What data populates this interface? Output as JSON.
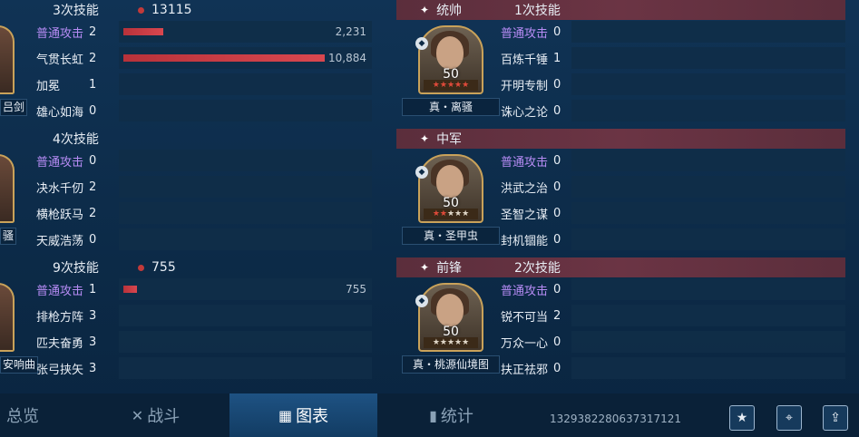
{
  "left_groups": [
    {
      "header": {
        "count": "3次技能",
        "damage": "13115"
      },
      "hero_name_fragment": "吕剑",
      "rows": [
        {
          "name": "普通攻击",
          "level": "2",
          "value": "2,231",
          "fraction": 0.16,
          "purple": true
        },
        {
          "name": "气贯长虹",
          "level": "2",
          "value": "10,884",
          "fraction": 0.8,
          "purple": false
        },
        {
          "name": "加冕",
          "level": "1",
          "value": "",
          "fraction": 0,
          "purple": false
        },
        {
          "name": "雄心如海",
          "level": "0",
          "value": "",
          "fraction": 0,
          "purple": false
        }
      ]
    },
    {
      "header": {
        "count": "4次技能",
        "damage": ""
      },
      "hero_name_fragment": "骚",
      "rows": [
        {
          "name": "普通攻击",
          "level": "0",
          "value": "",
          "fraction": 0,
          "purple": true
        },
        {
          "name": "决水千仞",
          "level": "2",
          "value": "",
          "fraction": 0,
          "purple": false
        },
        {
          "name": "横枪跃马",
          "level": "2",
          "value": "",
          "fraction": 0,
          "purple": false
        },
        {
          "name": "天威浩荡",
          "level": "0",
          "value": "",
          "fraction": 0,
          "purple": false
        }
      ]
    },
    {
      "header": {
        "count": "9次技能",
        "damage": "755"
      },
      "hero_name_fragment": "安响曲",
      "rows": [
        {
          "name": "普通攻击",
          "level": "1",
          "value": "755",
          "fraction": 0.055,
          "purple": true
        },
        {
          "name": "排枪方阵",
          "level": "3",
          "value": "",
          "fraction": 0,
          "purple": false
        },
        {
          "name": "匹夫奋勇",
          "level": "3",
          "value": "",
          "fraction": 0,
          "purple": false
        },
        {
          "name": "张弓挟矢",
          "level": "3",
          "value": "",
          "fraction": 0,
          "purple": false
        }
      ]
    }
  ],
  "right_groups": [
    {
      "header": {
        "role": "统帅",
        "count": "1次技能"
      },
      "hero": {
        "level": "50",
        "name": "真・离骚",
        "stars_red": 5,
        "stars_total": 5
      },
      "rows": [
        {
          "name": "普通攻击",
          "level": "0",
          "purple": true
        },
        {
          "name": "百炼千锤",
          "level": "1",
          "purple": false
        },
        {
          "name": "开明专制",
          "level": "0",
          "purple": false
        },
        {
          "name": "诛心之论",
          "level": "0",
          "purple": false
        }
      ]
    },
    {
      "header": {
        "role": "中军",
        "count": ""
      },
      "hero": {
        "level": "50",
        "name": "真・圣甲虫",
        "stars_red": 2,
        "stars_total": 5
      },
      "rows": [
        {
          "name": "普通攻击",
          "level": "0",
          "purple": true
        },
        {
          "name": "洪武之治",
          "level": "0",
          "purple": false
        },
        {
          "name": "圣智之谋",
          "level": "0",
          "purple": false
        },
        {
          "name": "封机锢能",
          "level": "0",
          "purple": false
        }
      ]
    },
    {
      "header": {
        "role": "前锋",
        "count": "2次技能"
      },
      "hero": {
        "level": "50",
        "name": "真・桃源仙境图",
        "stars_red": 0,
        "stars_total": 5
      },
      "rows": [
        {
          "name": "普通攻击",
          "level": "0",
          "purple": true
        },
        {
          "name": "锐不可当",
          "level": "2",
          "purple": false
        },
        {
          "name": "万众一心",
          "level": "0",
          "purple": false
        },
        {
          "name": "扶正祛邪",
          "level": "0",
          "purple": false
        }
      ]
    }
  ],
  "tabs": [
    {
      "label": "总览",
      "icon": "overview-icon"
    },
    {
      "label": "战斗",
      "icon": "crossed-swords-icon"
    },
    {
      "label": "图表",
      "icon": "chart-icon"
    },
    {
      "label": "统计",
      "icon": "bar-stats-icon"
    }
  ],
  "active_tab": "图表",
  "battle_id": "1329382280637317121",
  "icons": {
    "favorite": "star-icon",
    "location": "location-pin-icon",
    "share": "share-icon"
  },
  "colors": {
    "damage_bar": "#c9343c",
    "skill_purple": "#b78cf5",
    "header_red": "#5b2e3c"
  }
}
